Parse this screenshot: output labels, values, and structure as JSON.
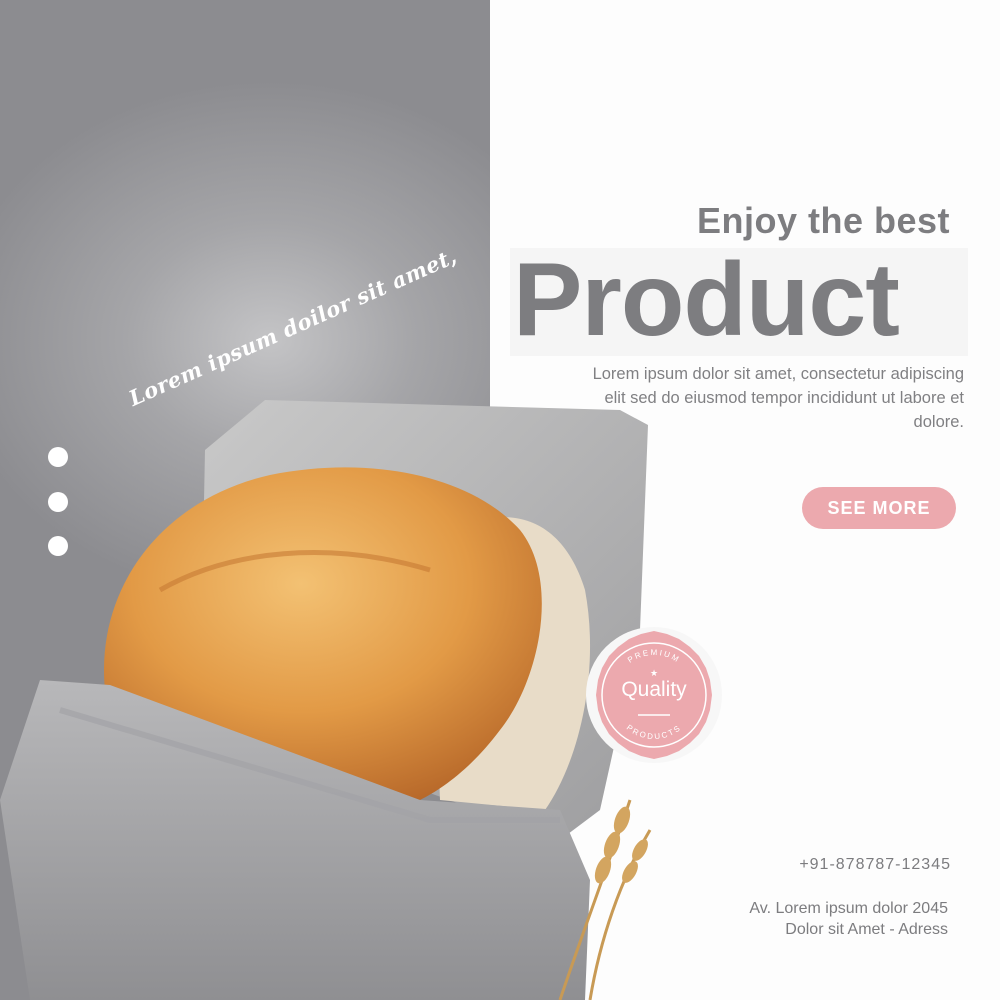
{
  "colors": {
    "panel_gray": "#8c8c90",
    "headline_gray": "#7d7d80",
    "accent_pink": "#eca9ae",
    "background": "#fdfdfd"
  },
  "tagline": "Lorem ipsum doilor sit amet,",
  "headline": {
    "small": "Enjoy the best",
    "big": "Product"
  },
  "description": "Lorem ipsum dolor sit amet, consectetur adipiscing elit sed do eiusmod tempor incididunt ut labore et dolore.",
  "cta": {
    "label": "SEE  MORE"
  },
  "badge": {
    "top_text": "PREMIUM",
    "title": "Quality",
    "bottom_text": "PRODUCTS",
    "icon": "star-icon"
  },
  "carousel_dots": 3,
  "contact": {
    "phone": "+91-878787-12345",
    "address_line1": "Av. Lorem ipsum dolor 2045",
    "address_line2": "Dolor sit Amet - Adress"
  },
  "photo": {
    "subject": "bread-loaf-in-linen-cloth-with-wheat"
  }
}
